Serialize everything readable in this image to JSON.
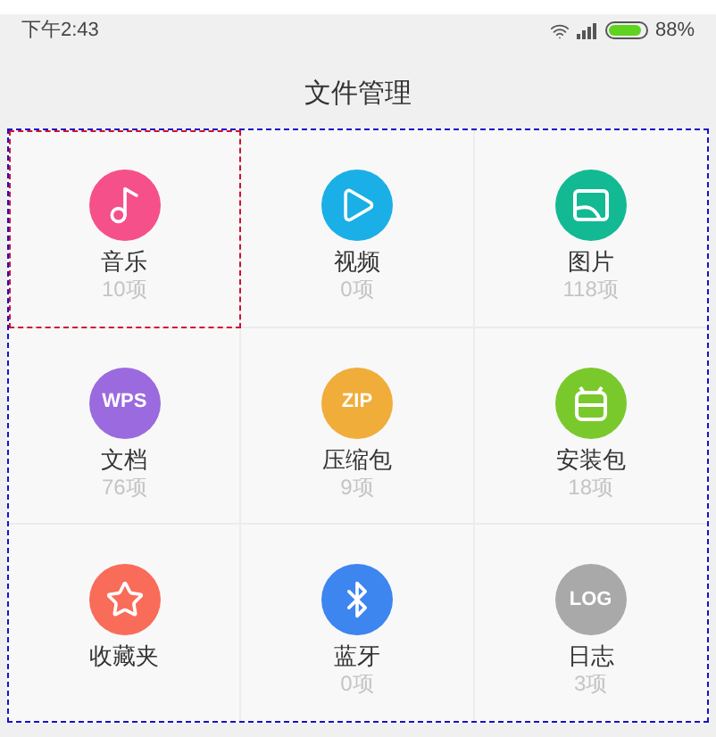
{
  "status_bar": {
    "time": "下午2:43",
    "battery_percent": "88%"
  },
  "title_bar": {
    "title": "文件管理"
  },
  "categories": [
    {
      "name": "音乐",
      "count": "10项",
      "color": "#f5508a",
      "outlined": true
    },
    {
      "name": "视频",
      "count": "0项",
      "color": "#1aafe6",
      "outlined": false
    },
    {
      "name": "图片",
      "count": "118项",
      "color": "#13b993",
      "outlined": false
    },
    {
      "name": "文档",
      "count": "76项",
      "icon_text": "WPS",
      "color": "#9b6ade",
      "outlined": false
    },
    {
      "name": "压缩包",
      "count": "9项",
      "icon_text": "ZIP",
      "color": "#f0ad3a",
      "outlined": false
    },
    {
      "name": "安装包",
      "count": "18项",
      "color": "#79c92c",
      "outlined": false
    },
    {
      "name": "收藏夹",
      "color": "#f96c5a",
      "outlined": false
    },
    {
      "name": "蓝牙",
      "count": "0项",
      "color": "#3d85ef",
      "outlined": false
    },
    {
      "name": "日志",
      "count": "3项",
      "icon_text": "LOG",
      "color": "#a9a9a9",
      "outlined": false
    }
  ]
}
